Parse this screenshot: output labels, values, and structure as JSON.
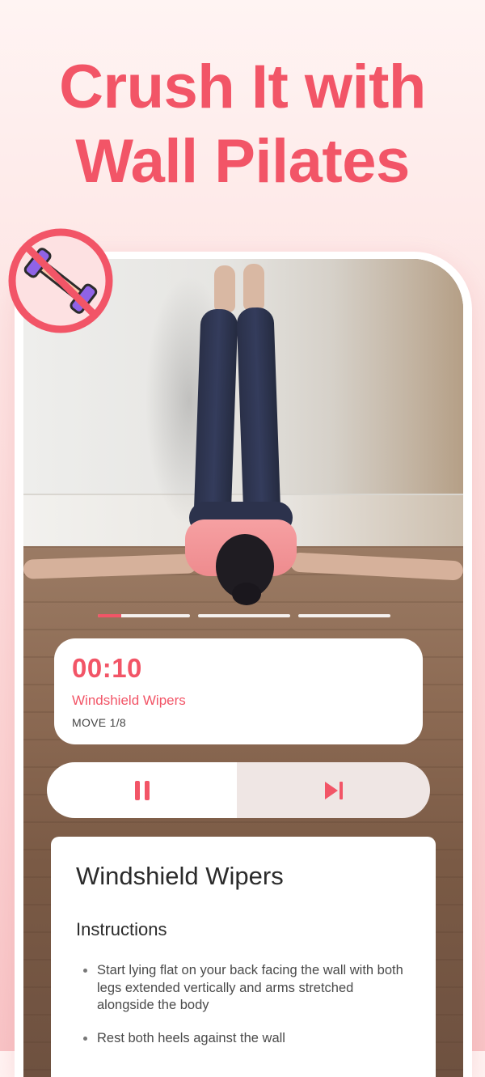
{
  "headline": {
    "line1": "Crush It with",
    "line2": "Wall Pilates"
  },
  "badge": {
    "icon": "no-dumbbell-icon",
    "ring_color": "#f25567",
    "fill_color": "#fde1e2"
  },
  "video": {
    "progress": {
      "segments": 3,
      "current_index": 0,
      "current_fraction": 0.25
    }
  },
  "timer": {
    "time": "00:10",
    "move_name": "Windshield Wipers",
    "move_counter": "MOVE 1/8"
  },
  "controls": {
    "pause_icon": "pause-icon",
    "next_icon": "skip-next-icon"
  },
  "instructions": {
    "title": "Windshield Wipers",
    "heading": "Instructions",
    "steps": [
      "Start lying flat on your back facing the wall with both legs extended vertically and arms stretched alongside the body",
      "Rest both heels against the wall"
    ]
  },
  "colors": {
    "accent": "#f25567",
    "sheet_bg": "#ffffff",
    "next_bg": "#efe6e4"
  }
}
